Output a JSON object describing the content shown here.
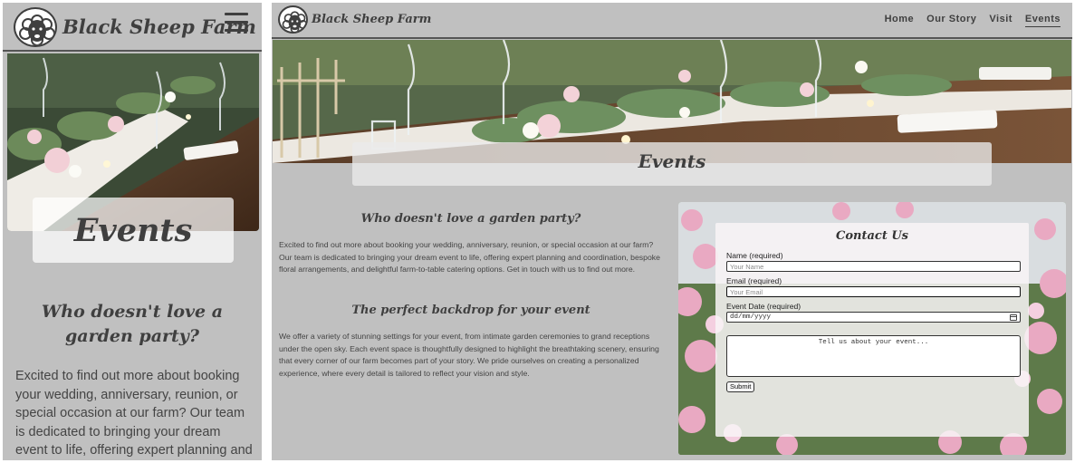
{
  "brand": {
    "name": "Black Sheep Farm",
    "logo_icon": "sheep-logo-icon"
  },
  "nav": {
    "menu_icon": "hamburger-menu-icon",
    "items": [
      {
        "label": "Home"
      },
      {
        "label": "Our Story"
      },
      {
        "label": "Visit"
      },
      {
        "label": "Events",
        "active": true
      }
    ]
  },
  "hero": {
    "title": "Events",
    "image": "wedding-table-setting"
  },
  "intro": {
    "heading": "Who doesn't love a garden party?",
    "body": "Excited to find out more about booking your wedding, anniversary, reunion, or special occasion at our farm? Our team is dedicated to bringing your dream event to life, offering expert planning and coordination, bespoke floral arrangements, and delightful farm-to-table catering options. Get in touch with us to find out more.",
    "mobile_body": "Excited to find out more about booking your wedding, anniversary, reunion, or special occasion at our farm? Our team is dedicated to bringing your dream event to life, offering expert planning and"
  },
  "backdrop": {
    "heading": "The perfect backdrop for your event",
    "body": "We offer a variety of stunning settings for your event, from intimate garden ceremonies to grand receptions under the open sky. Each event space is thoughtfully designed to highlight the breathtaking scenery, ensuring that every corner of our farm becomes part of your story. We pride ourselves on creating a personalized experience, where every detail is tailored to reflect your vision and style."
  },
  "contact": {
    "title": "Contact Us",
    "background_image": "sweet-pea-flowers",
    "name_label": "Name (required)",
    "name_placeholder": "Your Name",
    "email_label": "Email (required)",
    "email_placeholder": "Your Email",
    "date_label": "Event Date (required)",
    "date_value": "dd/mm/yyyy",
    "message_placeholder": "Tell us about your event...",
    "submit_label": "Submit"
  },
  "colors": {
    "page_bg": "#c0c0c0",
    "text": "#3f3f3f",
    "overlay": "#ffffff"
  }
}
